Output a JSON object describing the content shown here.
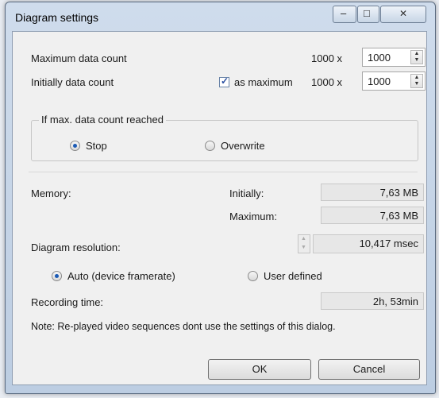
{
  "window": {
    "title": "Diagram settings",
    "minimize_glyph": "–",
    "maximize_glyph": "□",
    "close_glyph": "✕"
  },
  "max_data": {
    "label": "Maximum data count",
    "multiplier": "1000 x",
    "value": "1000"
  },
  "initial_data": {
    "label": "Initially data count",
    "checkbox_label": "as maximum",
    "checked": true,
    "multiplier": "1000 x",
    "value": "1000"
  },
  "max_reached": {
    "group_title": "If max. data count reached",
    "options": [
      "Stop",
      "Overwrite"
    ],
    "selected": "Stop"
  },
  "memory": {
    "label": "Memory:",
    "initially_label": "Initially:",
    "initially_value": "7,63 MB",
    "maximum_label": "Maximum:",
    "maximum_value": "7,63 MB"
  },
  "resolution": {
    "label": "Diagram resolution:",
    "value": "10,417 msec",
    "options": [
      "Auto (device framerate)",
      "User defined"
    ],
    "selected": "Auto (device framerate)"
  },
  "recording": {
    "label": "Recording time:",
    "value": "2h, 53min"
  },
  "note": "Note: Re-played video sequences dont use the settings of this dialog.",
  "buttons": {
    "ok": "OK",
    "cancel": "Cancel"
  },
  "icons": {
    "checkmark": "✓",
    "spin_up": "▲",
    "spin_down": "▼"
  },
  "colors": {
    "frame": "#c3d3e7",
    "client": "#f0f0f0",
    "radio_dot": "#1b5ab5"
  }
}
